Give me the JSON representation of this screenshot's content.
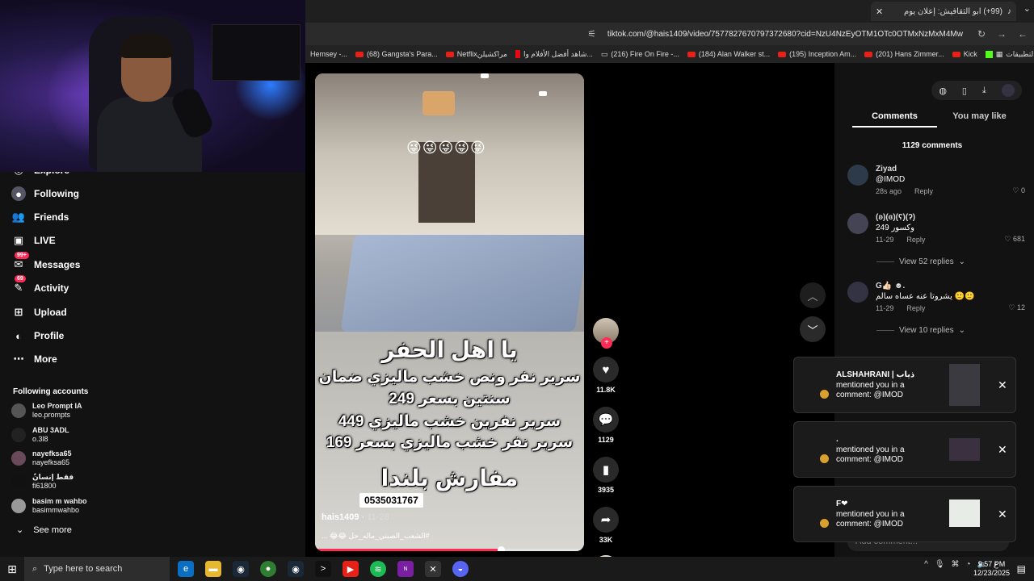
{
  "browser": {
    "tab_title": "(99+) ابو الثقافيش: إعلان يوم",
    "url": "tiktok.com/@hais1409/video/7577827670797372680?cid=NzU4NzEyOTM1OTc0OTMxNzMxM4Mw",
    "bookmarks": [
      {
        "label": "Hemsey -...",
        "icon": "none"
      },
      {
        "label": "(68) Gangsta's Para...",
        "icon": "youtube"
      },
      {
        "label": "Netflixمراكشيلن",
        "icon": "youtube"
      },
      {
        "label": "شاهد أفضل الأفلام وا...",
        "icon": "netflix"
      },
      {
        "label": "(216) Fire On Fire -...",
        "icon": "tv"
      },
      {
        "label": "(184) Alan Walker st...",
        "icon": "youtube"
      },
      {
        "label": "(195) Inception Am...",
        "icon": "youtube"
      },
      {
        "label": "(201) Hans Zimmer...",
        "icon": "youtube"
      },
      {
        "label": "Kick",
        "icon": "youtube"
      },
      {
        "label": "التطبيقات",
        "icon": "kick"
      }
    ]
  },
  "sidebar": {
    "items": [
      {
        "label": "Explore",
        "icon": "compass-icon"
      },
      {
        "label": "Following",
        "icon": "avatar-icon"
      },
      {
        "label": "Friends",
        "icon": "users-icon"
      },
      {
        "label": "LIVE",
        "icon": "live-icon"
      },
      {
        "label": "Messages",
        "icon": "message-icon",
        "badge": "99+"
      },
      {
        "label": "Activity",
        "icon": "bell-icon",
        "badge": "69"
      },
      {
        "label": "Upload",
        "icon": "upload-icon"
      },
      {
        "label": "Profile",
        "icon": "profile-icon"
      },
      {
        "label": "More",
        "icon": "more-icon"
      }
    ],
    "following_title": "Following accounts",
    "accounts": [
      {
        "name": "Leo Prompt IA",
        "handle": "leo.prompts"
      },
      {
        "name": "ABU 3ADL",
        "handle": "o.3l8"
      },
      {
        "name": "nayefksa65",
        "handle": "nayefksa65"
      },
      {
        "name": "فقط إنسانٌ",
        "handle": "fi61800"
      },
      {
        "name": "basim m wahbo",
        "handle": "basimmwahbo"
      }
    ],
    "see_more": "See more"
  },
  "video": {
    "emojis": "😜😜😜😜😜",
    "caption_lines": [
      "يا اهل الحفر",
      "سرير نفر ونص خشب ماليزي ضمان",
      "سنتين بسعر 249",
      "سرير نفرين خشب ماليزي 449",
      "سرير نفر خشب ماليزي بسعر 169",
      "مفارش بلندا"
    ],
    "phone": "0535031767",
    "author": "hais1409",
    "date": "11-28",
    "hashtags": "#الشعب_الصيني_ماله_حل 😂😂 ...",
    "progress": 0.69,
    "actions": {
      "likes": "11.8K",
      "comments": "1129",
      "saves": "3935",
      "shares": "33K"
    }
  },
  "panel": {
    "tabs": [
      "Comments",
      "You may like"
    ],
    "count": "1129 comments",
    "comments": [
      {
        "name": "Ziyad",
        "text": "@IMOD",
        "time": "28s ago",
        "reply": "Reply",
        "likes": "0"
      },
      {
        "name": "(ʚ)(ɞ)(ʕ)(ʔ)",
        "text": "وكسور 249",
        "time": "11-29",
        "reply": "Reply",
        "likes": "681"
      },
      {
        "name": "G👍🏻 ☻.",
        "text": "يشروتا عنه عساه سالم 🙂🙂",
        "time": "11-29",
        "reply": "Reply",
        "likes": "12"
      }
    ],
    "view_replies_1": "View 52 replies",
    "view_replies_2": "View 10 replies",
    "add_comment": "Add comment..."
  },
  "notifications": [
    {
      "title": "ALSHAHRANI | ذياب",
      "line1": "mentioned you in a",
      "line2": "comment: @IMOD"
    },
    {
      "title": ".",
      "line1": "mentioned you in a",
      "line2": "comment: @IMOD"
    },
    {
      "title": "F❤",
      "line1": "mentioned you in a",
      "line2": "comment: @IMOD"
    }
  ],
  "taskbar": {
    "search_placeholder": "Type here to search",
    "time": "9:57 PM",
    "date": "12/23/2025",
    "lang": "ع"
  },
  "colors": {
    "accent": "#fe2c55",
    "mention": "#6ea8fe"
  }
}
